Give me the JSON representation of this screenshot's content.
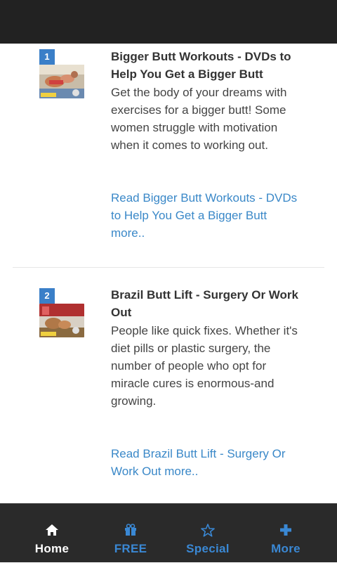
{
  "articles": [
    {
      "number": "1",
      "title": "Bigger Butt Workouts - DVDs to Help You Get a Bigger Butt",
      "summary": "Get the body of your dreams with exercises for a bigger butt! Some women struggle with motivation when it comes to working out.",
      "read_more": "Read Bigger Butt Workouts - DVDs to Help You Get a Bigger Butt more.."
    },
    {
      "number": "2",
      "title": "Brazil Butt Lift - Surgery Or Work Out",
      "summary": "People like quick fixes. Whether it's diet pills or plastic surgery, the number of people who opt for miracle cures is enormous-and growing.",
      "read_more": "Read Brazil Butt Lift - Surgery Or Work Out more.."
    }
  ],
  "bottom_nav": {
    "items": [
      {
        "label": "Home",
        "icon": "home-icon",
        "active": true
      },
      {
        "label": "FREE",
        "icon": "gift-icon",
        "active": false
      },
      {
        "label": "Special",
        "icon": "star-icon",
        "active": false
      },
      {
        "label": "More",
        "icon": "plus-icon",
        "active": false
      }
    ]
  },
  "colors": {
    "status_bar": "#222222",
    "nav_background": "#2a2a2a",
    "accent_blue": "#3a88d4",
    "badge_blue": "#3a7fc8",
    "link_blue": "#3a88c8",
    "title_text": "#333333"
  }
}
